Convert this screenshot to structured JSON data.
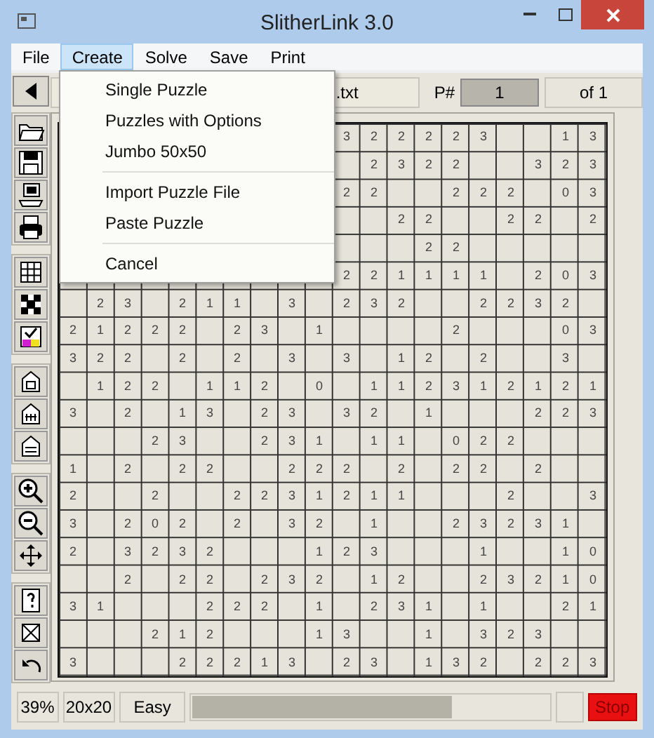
{
  "window": {
    "title": "SlitherLink 3.0"
  },
  "menu_bar": [
    {
      "label": "File",
      "selected": false
    },
    {
      "label": "Create",
      "selected": true
    },
    {
      "label": "Solve",
      "selected": false
    },
    {
      "label": "Save",
      "selected": false
    },
    {
      "label": "Print",
      "selected": false
    }
  ],
  "create_menu": {
    "groups": [
      [
        "Single Puzzle",
        "Puzzles with Options",
        "Jumbo 50x50"
      ],
      [
        "Import Puzzle File",
        "Paste Puzzle"
      ],
      [
        "Cancel"
      ]
    ]
  },
  "toolbar": {
    "file_name": ".txt",
    "puzzle_number_label": "P#",
    "puzzle_number": "1",
    "puzzle_count": "of 1"
  },
  "grid": {
    "rows": [
      [
        null,
        null,
        null,
        null,
        null,
        null,
        null,
        null,
        null,
        null,
        "3",
        "2",
        "2",
        "2",
        "2",
        "3",
        null,
        null,
        "1",
        "3"
      ],
      [
        null,
        null,
        null,
        null,
        null,
        null,
        null,
        null,
        null,
        null,
        null,
        "2",
        "3",
        "2",
        "2",
        null,
        null,
        "3",
        "2",
        "3"
      ],
      [
        null,
        null,
        null,
        null,
        null,
        null,
        null,
        null,
        null,
        null,
        "2",
        "2",
        null,
        null,
        "2",
        "2",
        "2",
        null,
        "0",
        "3"
      ],
      [
        null,
        null,
        null,
        null,
        null,
        null,
        null,
        null,
        null,
        null,
        null,
        null,
        "2",
        "2",
        null,
        null,
        "2",
        "2",
        null,
        "2"
      ],
      [
        null,
        null,
        null,
        null,
        null,
        null,
        null,
        null,
        null,
        null,
        null,
        null,
        null,
        "2",
        "2",
        null,
        null,
        null,
        null,
        null
      ],
      [
        null,
        null,
        null,
        null,
        null,
        null,
        null,
        null,
        null,
        null,
        "2",
        "2",
        "1",
        "1",
        "1",
        "1",
        null,
        "2",
        "0",
        "3"
      ],
      [
        null,
        "2",
        "3",
        null,
        "2",
        "1",
        "1",
        null,
        "3",
        null,
        "2",
        "3",
        "2",
        null,
        null,
        "2",
        "2",
        "3",
        "2",
        null
      ],
      [
        "2",
        "1",
        "2",
        "2",
        "2",
        null,
        "2",
        "3",
        null,
        "1",
        null,
        null,
        null,
        null,
        "2",
        null,
        null,
        null,
        "0",
        "3"
      ],
      [
        "3",
        "2",
        "2",
        null,
        "2",
        null,
        "2",
        null,
        "3",
        null,
        "3",
        null,
        "1",
        "2",
        null,
        "2",
        null,
        null,
        "3",
        null
      ],
      [
        null,
        "1",
        "2",
        "2",
        null,
        "1",
        "1",
        "2",
        null,
        "0",
        null,
        "1",
        "1",
        "2",
        "3",
        "1",
        "2",
        "1",
        "2",
        "1"
      ],
      [
        "3",
        null,
        "2",
        null,
        "1",
        "3",
        null,
        "2",
        "3",
        null,
        "3",
        "2",
        null,
        "1",
        null,
        null,
        null,
        "2",
        "2",
        "3"
      ],
      [
        null,
        null,
        null,
        "2",
        "3",
        null,
        null,
        "2",
        "3",
        "1",
        null,
        "1",
        "1",
        null,
        "0",
        "2",
        "2",
        null,
        null,
        null
      ],
      [
        "1",
        null,
        "2",
        null,
        "2",
        "2",
        null,
        null,
        "2",
        "2",
        "2",
        null,
        "2",
        null,
        "2",
        "2",
        null,
        "2",
        null,
        null
      ],
      [
        "2",
        null,
        null,
        "2",
        null,
        null,
        "2",
        "2",
        "3",
        "1",
        "2",
        "1",
        "1",
        null,
        null,
        null,
        "2",
        null,
        null,
        "3"
      ],
      [
        "3",
        null,
        "2",
        "0",
        "2",
        null,
        "2",
        null,
        "3",
        "2",
        null,
        "1",
        null,
        null,
        "2",
        "3",
        "2",
        "3",
        "1",
        null
      ],
      [
        "2",
        null,
        "3",
        "2",
        "3",
        "2",
        null,
        null,
        null,
        "1",
        "2",
        "3",
        null,
        null,
        null,
        "1",
        null,
        null,
        "1",
        "0"
      ],
      [
        null,
        null,
        "2",
        null,
        "2",
        "2",
        null,
        "2",
        "3",
        "2",
        null,
        "1",
        "2",
        null,
        null,
        "2",
        "3",
        "2",
        "1",
        "0"
      ],
      [
        "3",
        "1",
        null,
        null,
        null,
        "2",
        "2",
        "2",
        null,
        "1",
        null,
        "2",
        "3",
        "1",
        null,
        "1",
        null,
        null,
        "2",
        "1"
      ],
      [
        null,
        null,
        null,
        "2",
        "1",
        "2",
        null,
        null,
        null,
        "1",
        "3",
        null,
        null,
        "1",
        null,
        "3",
        "2",
        "3",
        null,
        null
      ],
      [
        "3",
        null,
        null,
        null,
        "2",
        "2",
        "2",
        "1",
        "3",
        null,
        "2",
        "3",
        null,
        "1",
        "3",
        "2",
        null,
        "2",
        "2",
        "3"
      ]
    ]
  },
  "status_bar": {
    "zoom": "39%",
    "size": "20x20",
    "difficulty": "Easy",
    "progress": {
      "level": 0.73
    },
    "stop_button": "Stop"
  }
}
